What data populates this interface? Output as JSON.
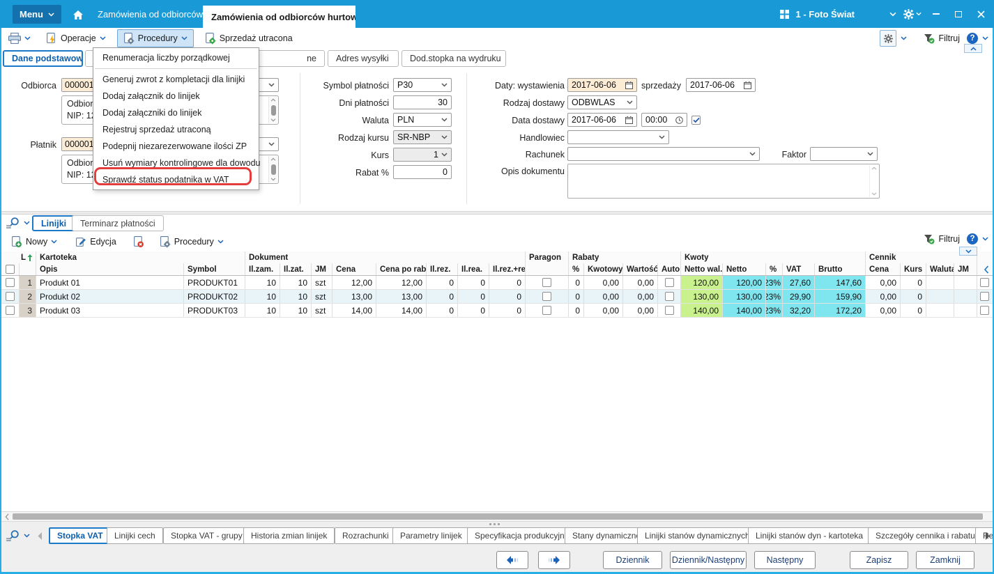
{
  "titlebar": {
    "menu_label": "Menu",
    "doc_tab_1": "Zamówienia od odbiorców",
    "doc_tab_2": "Zamówienia od odbiorców hurtowy",
    "company": "1 - Foto Świat"
  },
  "toolbar": {
    "operacje": "Operacje",
    "procedury": "Procedury",
    "sprzedaz_utracona": "Sprzedaż utracona",
    "filtruj": "Filtruj"
  },
  "procedury_menu": {
    "items": [
      "Renumeracja liczby porządkowej",
      "Generuj zwrot z kompletacji dla linijki",
      "Dodaj załącznik do linijek",
      "Dodaj załączniki do linijek",
      "Rejestruj sprzedaż utraconą",
      "Podepnij niezarezerwowane ilości ZP",
      "Usuń wymiary kontrolingowe dla dowodu",
      "Sprawdź status podatnika w VAT"
    ],
    "highlighted_item": "Sprawdź status podatnika w VAT"
  },
  "form_tabs": {
    "tab_1": "Dane podstawowe",
    "tab_2_fragment": "D",
    "tab_3_fragment": "ne",
    "tab_4": "Adres wysyłki",
    "tab_5": "Dod.stopka na wydruku",
    "active": "Dane podstawowe"
  },
  "form": {
    "odbiorca_label": "Odbiorca",
    "odbiorca_code": "000001",
    "odbiorca_info_line1": "Odbiorc",
    "odbiorca_info_line2": "NIP: 123",
    "platnik_label": "Płatnik",
    "platnik_code": "000001",
    "platnik_info_line1": "Odbiorc",
    "platnik_info_line2": "NIP: 123",
    "symbol_platnosci_label": "Symbol płatności",
    "symbol_platnosci_value": "P30",
    "dni_platnosci_label": "Dni płatności",
    "dni_platnosci_value": "30",
    "waluta_label": "Waluta",
    "waluta_value": "PLN",
    "rodzaj_kursu_label": "Rodzaj kursu",
    "rodzaj_kursu_value": "SR-NBP",
    "kurs_label": "Kurs",
    "kurs_value": "1",
    "rabat_label": "Rabat %",
    "rabat_value": "0",
    "daty_wystawienia_label": "Daty: wystawienia",
    "data_wystawienia": "2017-06-06",
    "sprzedazy_label": "sprzedaży",
    "data_sprzedazy": "2017-06-06",
    "rodzaj_dostawy_label": "Rodzaj dostawy",
    "rodzaj_dostawy_value": "ODBWLAS",
    "data_dostawy_label": "Data dostawy",
    "data_dostawy_value": "2017-06-06",
    "czas_dostawy_value": "00:00",
    "handlowiec_label": "Handlowiec",
    "rachunek_label": "Rachunek",
    "faktor_label": "Faktor",
    "opis_dokumentu_label": "Opis dokumentu"
  },
  "lines": {
    "tab_linijki": "Linijki",
    "tab_terminarz": "Terminarz płatności",
    "active_tab": "Linijki",
    "nowy": "Nowy",
    "edycja": "Edycja",
    "procedury": "Procedury",
    "filtruj": "Filtruj"
  },
  "table": {
    "sort_column": "L",
    "groups": {
      "kartoteka": "Kartoteka",
      "dokument": "Dokument",
      "paragon": "Paragon",
      "rabaty": "Rabaty",
      "kwoty": "Kwoty",
      "cennik": "Cennik"
    },
    "headers": {
      "opis": "Opis",
      "symbol": "Symbol",
      "il_zam": "Il.zam.",
      "il_zat": "Il.zat.",
      "jm": "JM",
      "cena": "Cena",
      "cena_po_rab": "Cena po rab.",
      "il_rez": "Il.rez.",
      "il_rea": "Il.rea.",
      "il_rez_rea": "Il.rez.+rea.",
      "rab_proc": "%",
      "kwotowy": "Kwotowy",
      "wartosc": "Wartość",
      "auto": "Auto",
      "netto_wal": "Netto wal.",
      "netto": "Netto",
      "vat_proc": "%",
      "vat": "VAT",
      "brutto": "Brutto",
      "c_cena": "Cena",
      "c_kurs": "Kurs",
      "c_waluta": "Waluta",
      "c_jm": "JM"
    },
    "rows": [
      {
        "num": "1",
        "opis": "Produkt 01",
        "symbol": "PRODUKT01",
        "il_zam": "10",
        "il_zat": "10",
        "jm": "szt",
        "cena": "12,00",
        "cena_po_rab": "12,00",
        "il_rez": "0",
        "il_rea": "0",
        "il_rez_rea": "0",
        "rab_proc": "0",
        "kwotowy": "0,00",
        "wartosc": "0,00",
        "netto_wal": "120,00",
        "netto": "120,00",
        "vat_proc": "23%",
        "vat": "27,60",
        "brutto": "147,60",
        "c_cena": "0,00",
        "c_kurs": "0",
        "c_waluta": "",
        "c_jm": ""
      },
      {
        "num": "2",
        "opis": "Produkt 02",
        "symbol": "PRODUKT02",
        "il_zam": "10",
        "il_zat": "10",
        "jm": "szt",
        "cena": "13,00",
        "cena_po_rab": "13,00",
        "il_rez": "0",
        "il_rea": "0",
        "il_rez_rea": "0",
        "rab_proc": "0",
        "kwotowy": "0,00",
        "wartosc": "0,00",
        "netto_wal": "130,00",
        "netto": "130,00",
        "vat_proc": "23%",
        "vat": "29,90",
        "brutto": "159,90",
        "c_cena": "0,00",
        "c_kurs": "0",
        "c_waluta": "",
        "c_jm": ""
      },
      {
        "num": "3",
        "opis": "Produkt 03",
        "symbol": "PRODUKT03",
        "il_zam": "10",
        "il_zat": "10",
        "jm": "szt",
        "cena": "14,00",
        "cena_po_rab": "14,00",
        "il_rez": "0",
        "il_rea": "0",
        "il_rez_rea": "0",
        "rab_proc": "0",
        "kwotowy": "0,00",
        "wartosc": "0,00",
        "netto_wal": "140,00",
        "netto": "140,00",
        "vat_proc": "23%",
        "vat": "32,20",
        "brutto": "172,20",
        "c_cena": "0,00",
        "c_kurs": "0",
        "c_waluta": "",
        "c_jm": ""
      }
    ]
  },
  "bottom_tabs": {
    "tabs": [
      "Stopka VAT",
      "Linijki cech",
      "Stopka VAT - grupy",
      "Historia zmian linijek",
      "Rozrachunki",
      "Parametry linijek",
      "Specyfikacja produkcyjna",
      "Stany dynamiczne",
      "Linijki stanów dynamicznych",
      "Linijki stanów dyn - kartoteka",
      "Szczegóły cennika i rabatu",
      "Rezerw"
    ],
    "active": "Stopka VAT"
  },
  "bottom_buttons": {
    "dziennik": "Dziennik",
    "dziennik_nastepny": "Dziennik/Następny",
    "nastepny": "Następny",
    "zapisz": "Zapisz",
    "zamknij": "Zamknij"
  },
  "icons": {
    "help": "?"
  },
  "colors": {
    "titlebar_blue": "#199ad6",
    "menu_button_blue": "#1371ae",
    "accent_blue": "#1c79c8",
    "highlight_field_orange": "#fcecd5",
    "cell_green": "#c9f18e",
    "cell_cyan": "#7fe5ef",
    "row_alt_blue": "#e9f4f9",
    "annotation_red": "#e23c3c",
    "window_frame_cyan": "#27aee6"
  }
}
